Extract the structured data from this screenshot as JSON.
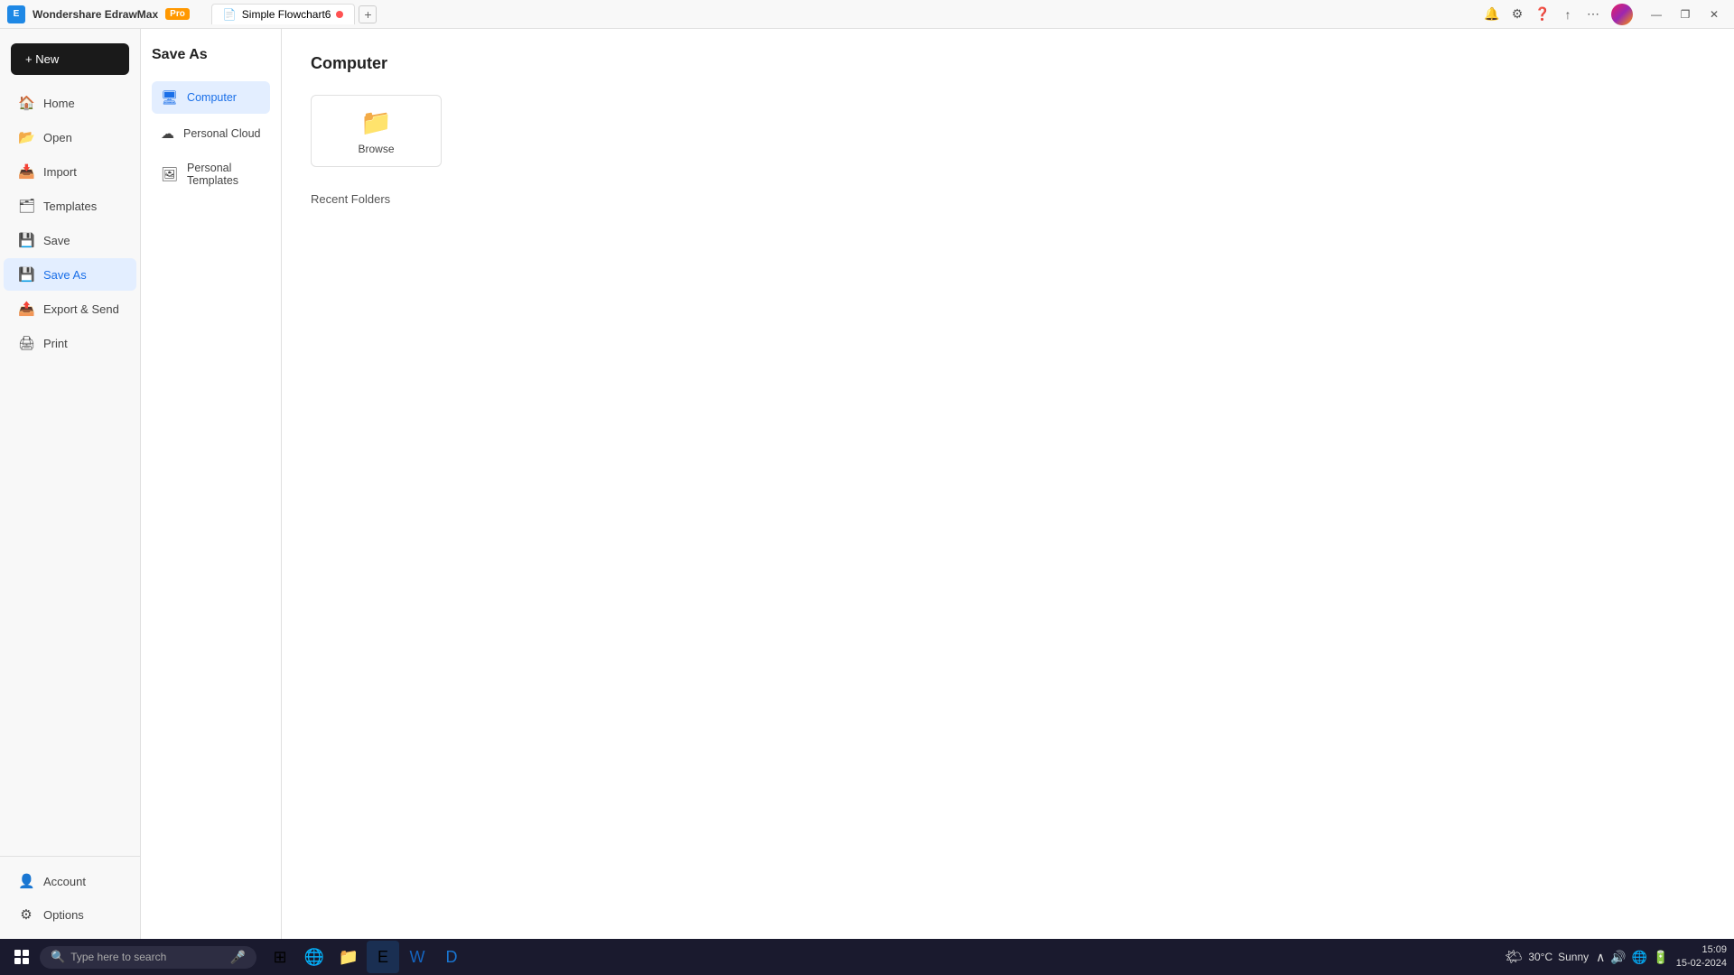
{
  "titlebar": {
    "app_name": "Wondershare EdrawMax",
    "pro_label": "Pro",
    "tab_label": "Simple Flowchart6",
    "tab_add": "+",
    "avatar_alt": "user-avatar"
  },
  "window_controls": {
    "minimize": "—",
    "restore": "❐",
    "close": "✕"
  },
  "sidebar": {
    "new_label": "+ New",
    "items": [
      {
        "id": "home",
        "icon": "🏠",
        "label": "Home"
      },
      {
        "id": "open",
        "icon": "📂",
        "label": "Open"
      },
      {
        "id": "import",
        "icon": "📥",
        "label": "Import"
      },
      {
        "id": "templates",
        "icon": "🗂",
        "label": "Templates"
      },
      {
        "id": "save",
        "icon": "💾",
        "label": "Save"
      },
      {
        "id": "save-as",
        "icon": "💾",
        "label": "Save As",
        "active": true
      },
      {
        "id": "export",
        "icon": "📤",
        "label": "Export & Send"
      },
      {
        "id": "print",
        "icon": "🖨",
        "label": "Print"
      }
    ],
    "bottom_items": [
      {
        "id": "account",
        "icon": "👤",
        "label": "Account"
      },
      {
        "id": "options",
        "icon": "⚙",
        "label": "Options"
      }
    ]
  },
  "save_as_panel": {
    "title": "Save As",
    "options": [
      {
        "id": "computer",
        "icon": "🖥",
        "label": "Computer",
        "active": true
      },
      {
        "id": "personal-cloud",
        "icon": "☁",
        "label": "Personal Cloud"
      },
      {
        "id": "personal-templates",
        "icon": "🖼",
        "label": "Personal Templates"
      }
    ]
  },
  "content": {
    "title": "Computer",
    "browse_label": "Browse",
    "recent_folders_label": "Recent Folders"
  },
  "taskbar": {
    "search_placeholder": "Type here to search",
    "weather_temp": "30°C",
    "weather_condition": "Sunny",
    "time": "15:09",
    "date": "15-02-2024"
  }
}
